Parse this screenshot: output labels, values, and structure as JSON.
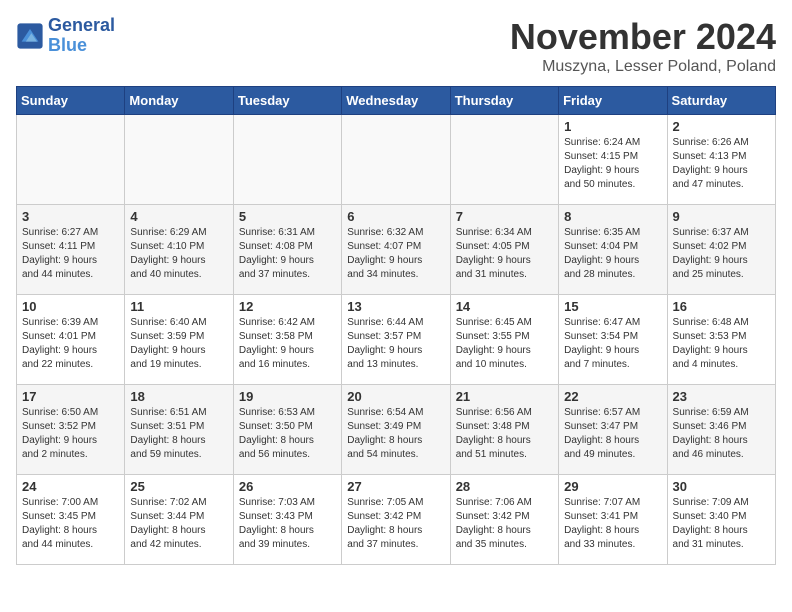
{
  "logo": {
    "line1": "General",
    "line2": "Blue"
  },
  "title": "November 2024",
  "location": "Muszyna, Lesser Poland, Poland",
  "days_of_week": [
    "Sunday",
    "Monday",
    "Tuesday",
    "Wednesday",
    "Thursday",
    "Friday",
    "Saturday"
  ],
  "weeks": [
    [
      {
        "day": "",
        "info": ""
      },
      {
        "day": "",
        "info": ""
      },
      {
        "day": "",
        "info": ""
      },
      {
        "day": "",
        "info": ""
      },
      {
        "day": "",
        "info": ""
      },
      {
        "day": "1",
        "info": "Sunrise: 6:24 AM\nSunset: 4:15 PM\nDaylight: 9 hours\nand 50 minutes."
      },
      {
        "day": "2",
        "info": "Sunrise: 6:26 AM\nSunset: 4:13 PM\nDaylight: 9 hours\nand 47 minutes."
      }
    ],
    [
      {
        "day": "3",
        "info": "Sunrise: 6:27 AM\nSunset: 4:11 PM\nDaylight: 9 hours\nand 44 minutes."
      },
      {
        "day": "4",
        "info": "Sunrise: 6:29 AM\nSunset: 4:10 PM\nDaylight: 9 hours\nand 40 minutes."
      },
      {
        "day": "5",
        "info": "Sunrise: 6:31 AM\nSunset: 4:08 PM\nDaylight: 9 hours\nand 37 minutes."
      },
      {
        "day": "6",
        "info": "Sunrise: 6:32 AM\nSunset: 4:07 PM\nDaylight: 9 hours\nand 34 minutes."
      },
      {
        "day": "7",
        "info": "Sunrise: 6:34 AM\nSunset: 4:05 PM\nDaylight: 9 hours\nand 31 minutes."
      },
      {
        "day": "8",
        "info": "Sunrise: 6:35 AM\nSunset: 4:04 PM\nDaylight: 9 hours\nand 28 minutes."
      },
      {
        "day": "9",
        "info": "Sunrise: 6:37 AM\nSunset: 4:02 PM\nDaylight: 9 hours\nand 25 minutes."
      }
    ],
    [
      {
        "day": "10",
        "info": "Sunrise: 6:39 AM\nSunset: 4:01 PM\nDaylight: 9 hours\nand 22 minutes."
      },
      {
        "day": "11",
        "info": "Sunrise: 6:40 AM\nSunset: 3:59 PM\nDaylight: 9 hours\nand 19 minutes."
      },
      {
        "day": "12",
        "info": "Sunrise: 6:42 AM\nSunset: 3:58 PM\nDaylight: 9 hours\nand 16 minutes."
      },
      {
        "day": "13",
        "info": "Sunrise: 6:44 AM\nSunset: 3:57 PM\nDaylight: 9 hours\nand 13 minutes."
      },
      {
        "day": "14",
        "info": "Sunrise: 6:45 AM\nSunset: 3:55 PM\nDaylight: 9 hours\nand 10 minutes."
      },
      {
        "day": "15",
        "info": "Sunrise: 6:47 AM\nSunset: 3:54 PM\nDaylight: 9 hours\nand 7 minutes."
      },
      {
        "day": "16",
        "info": "Sunrise: 6:48 AM\nSunset: 3:53 PM\nDaylight: 9 hours\nand 4 minutes."
      }
    ],
    [
      {
        "day": "17",
        "info": "Sunrise: 6:50 AM\nSunset: 3:52 PM\nDaylight: 9 hours\nand 2 minutes."
      },
      {
        "day": "18",
        "info": "Sunrise: 6:51 AM\nSunset: 3:51 PM\nDaylight: 8 hours\nand 59 minutes."
      },
      {
        "day": "19",
        "info": "Sunrise: 6:53 AM\nSunset: 3:50 PM\nDaylight: 8 hours\nand 56 minutes."
      },
      {
        "day": "20",
        "info": "Sunrise: 6:54 AM\nSunset: 3:49 PM\nDaylight: 8 hours\nand 54 minutes."
      },
      {
        "day": "21",
        "info": "Sunrise: 6:56 AM\nSunset: 3:48 PM\nDaylight: 8 hours\nand 51 minutes."
      },
      {
        "day": "22",
        "info": "Sunrise: 6:57 AM\nSunset: 3:47 PM\nDaylight: 8 hours\nand 49 minutes."
      },
      {
        "day": "23",
        "info": "Sunrise: 6:59 AM\nSunset: 3:46 PM\nDaylight: 8 hours\nand 46 minutes."
      }
    ],
    [
      {
        "day": "24",
        "info": "Sunrise: 7:00 AM\nSunset: 3:45 PM\nDaylight: 8 hours\nand 44 minutes."
      },
      {
        "day": "25",
        "info": "Sunrise: 7:02 AM\nSunset: 3:44 PM\nDaylight: 8 hours\nand 42 minutes."
      },
      {
        "day": "26",
        "info": "Sunrise: 7:03 AM\nSunset: 3:43 PM\nDaylight: 8 hours\nand 39 minutes."
      },
      {
        "day": "27",
        "info": "Sunrise: 7:05 AM\nSunset: 3:42 PM\nDaylight: 8 hours\nand 37 minutes."
      },
      {
        "day": "28",
        "info": "Sunrise: 7:06 AM\nSunset: 3:42 PM\nDaylight: 8 hours\nand 35 minutes."
      },
      {
        "day": "29",
        "info": "Sunrise: 7:07 AM\nSunset: 3:41 PM\nDaylight: 8 hours\nand 33 minutes."
      },
      {
        "day": "30",
        "info": "Sunrise: 7:09 AM\nSunset: 3:40 PM\nDaylight: 8 hours\nand 31 minutes."
      }
    ]
  ]
}
